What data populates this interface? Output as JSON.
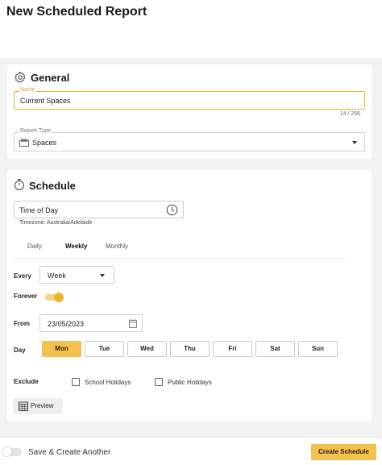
{
  "header": {
    "title": "New Scheduled Report"
  },
  "general": {
    "title": "General",
    "icon": "gear-icon",
    "name": {
      "label": "Name",
      "value": "Current Spaces",
      "counter": "14 / 256"
    },
    "report_type": {
      "label": "Report Type",
      "value": "Spaces",
      "icon": "spaces-icon"
    }
  },
  "schedule": {
    "title": "Schedule",
    "icon": "stopwatch-icon",
    "time": {
      "value": "Time of Day",
      "icon": "clock-icon"
    },
    "timezone": "Timezone: Australia/Adelaide",
    "tabs": [
      {
        "label": "Daily",
        "active": false
      },
      {
        "label": "Weekly",
        "active": true
      },
      {
        "label": "Monthly",
        "active": false
      }
    ],
    "every": {
      "label": "Every",
      "value": "Week"
    },
    "forever": {
      "label": "Forever",
      "on": true
    },
    "from": {
      "label": "From",
      "value": "23/05/2023",
      "icon": "calendar-icon"
    },
    "day": {
      "label": "Day",
      "days": [
        {
          "label": "Mon",
          "selected": true
        },
        {
          "label": "Tue",
          "selected": false
        },
        {
          "label": "Wed",
          "selected": false
        },
        {
          "label": "Thu",
          "selected": false
        },
        {
          "label": "Fri",
          "selected": false
        },
        {
          "label": "Sat",
          "selected": false
        },
        {
          "label": "Sun",
          "selected": false
        }
      ]
    },
    "exclude": {
      "label": "Exclude",
      "options": [
        {
          "label": "School Holidays",
          "checked": false
        },
        {
          "label": "Public Holidays",
          "checked": false
        }
      ]
    },
    "preview": {
      "label": "Preview",
      "icon": "calendar-grid-icon"
    }
  },
  "footer": {
    "save_create_another": "Save & Create Another",
    "toggle_on": false,
    "create_button": "Create Schedule"
  },
  "colors": {
    "accent": "#f5c04d",
    "accent_dark": "#e8b62c"
  }
}
